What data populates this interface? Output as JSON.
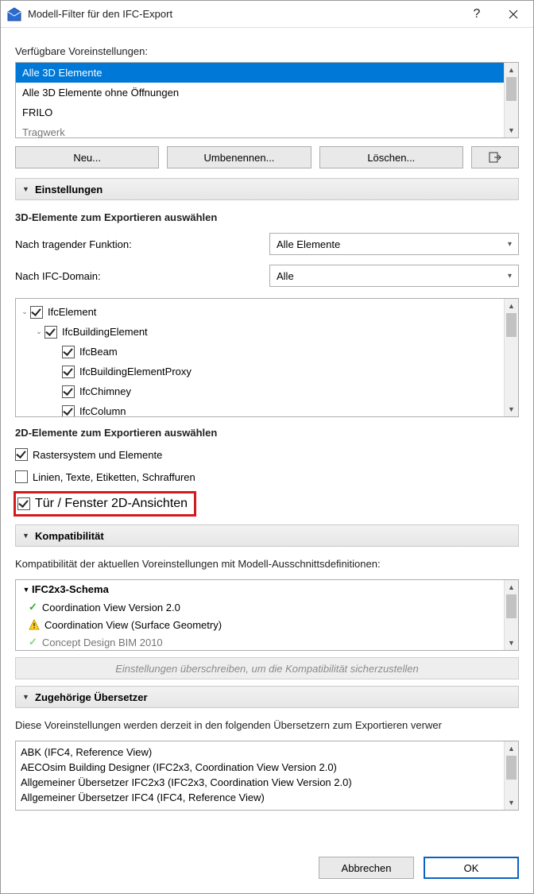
{
  "titlebar": {
    "title": "Modell-Filter für den IFC-Export"
  },
  "presets": {
    "label": "Verfügbare Voreinstellungen:",
    "items": [
      "Alle 3D Elemente",
      "Alle 3D Elemente ohne Öffnungen",
      "FRILO",
      "Tragwerk"
    ],
    "selected_index": 0
  },
  "buttons": {
    "new": "Neu...",
    "rename": "Umbenennen...",
    "delete": "Löschen..."
  },
  "sections": {
    "settings": "Einstellungen",
    "compat": "Kompatibilität",
    "translators": "Zugehörige Übersetzer"
  },
  "elements3d": {
    "heading": "3D-Elemente zum Exportieren auswählen",
    "by_function_label": "Nach tragender Funktion:",
    "by_function_value": "Alle Elemente",
    "by_domain_label": "Nach IFC-Domain:",
    "by_domain_value": "Alle",
    "tree": {
      "root": "IfcElement",
      "child": "IfcBuildingElement",
      "leaves": [
        "IfcBeam",
        "IfcBuildingElementProxy",
        "IfcChimney",
        "IfcColumn"
      ]
    }
  },
  "elements2d": {
    "heading": "2D-Elemente zum Exportieren auswählen",
    "grid": "Rastersystem und Elemente",
    "lines": "Linien, Texte, Etiketten, Schraffuren",
    "doorwindow": "Tür / Fenster 2D-Ansichten"
  },
  "compat": {
    "desc": "Kompatibilität der aktuellen Voreinstellungen mit Modell-Ausschnittsdefinitionen:",
    "schema": "IFC2x3-Schema",
    "rows": [
      {
        "status": "ok",
        "text": "Coordination View Version 2.0"
      },
      {
        "status": "warn",
        "text": "Coordination View (Surface Geometry)"
      },
      {
        "status": "ok",
        "text": "Concept Design BIM 2010"
      }
    ],
    "override_btn": "Einstellungen überschreiben, um die Kompatibilität sicherzustellen"
  },
  "translators": {
    "desc": "Diese Voreinstellungen werden derzeit in den folgenden Übersetzern zum Exportieren verwer",
    "items": [
      "ABK (IFC4, Reference View)",
      "AECOsim Building Designer (IFC2x3, Coordination View Version 2.0)",
      "Allgemeiner Übersetzer IFC2x3 (IFC2x3, Coordination View Version 2.0)",
      "Allgemeiner Übersetzer IFC4 (IFC4, Reference View)"
    ]
  },
  "footer": {
    "cancel": "Abbrechen",
    "ok": "OK"
  }
}
